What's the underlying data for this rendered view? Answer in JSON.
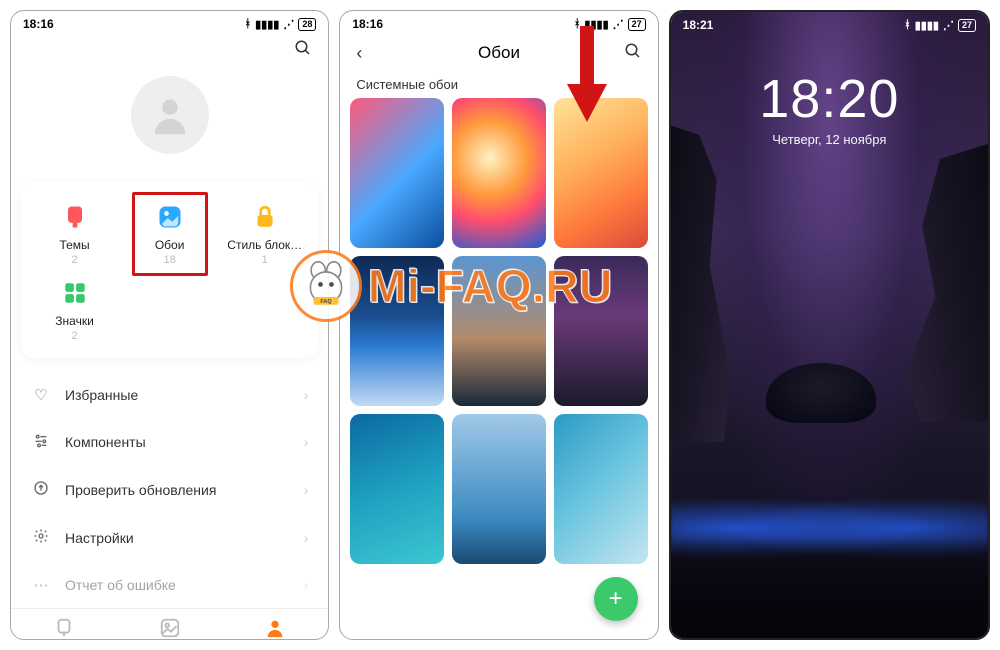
{
  "watermark": "Mi-FAQ.RU",
  "screen1": {
    "status": {
      "time": "18:16",
      "battery": "28"
    },
    "tiles": [
      {
        "label": "Темы",
        "count": "2",
        "color": "#ff5757",
        "icon": "themes"
      },
      {
        "label": "Обои",
        "count": "18",
        "color": "#2aa8ff",
        "icon": "wallpapers",
        "highlight": true
      },
      {
        "label": "Стиль блок…",
        "count": "1",
        "color": "#ffb81a",
        "icon": "lock-style"
      },
      {
        "label": "Значки",
        "count": "2",
        "color": "#35c96c",
        "icon": "icons"
      }
    ],
    "list": [
      {
        "icon": "♡",
        "label": "Избранные"
      },
      {
        "icon": "⚙",
        "label": "Компоненты",
        "iconName": "sliders-icon"
      },
      {
        "icon": "↑",
        "label": "Проверить обновления",
        "iconName": "update-icon"
      },
      {
        "icon": "⚙",
        "label": "Настройки",
        "iconName": "gear-icon"
      },
      {
        "icon": "⋯",
        "label": "Отчет об ошибке",
        "iconName": "report-icon"
      }
    ],
    "tabs": {
      "active": 2
    }
  },
  "screen2": {
    "status": {
      "time": "18:16",
      "battery": "27"
    },
    "title": "Обои",
    "section": "Системные обои"
  },
  "screen3": {
    "status": {
      "time": "18:21",
      "battery": "27"
    },
    "lock_time": "18:20",
    "lock_date": "Четверг, 12 ноября"
  }
}
